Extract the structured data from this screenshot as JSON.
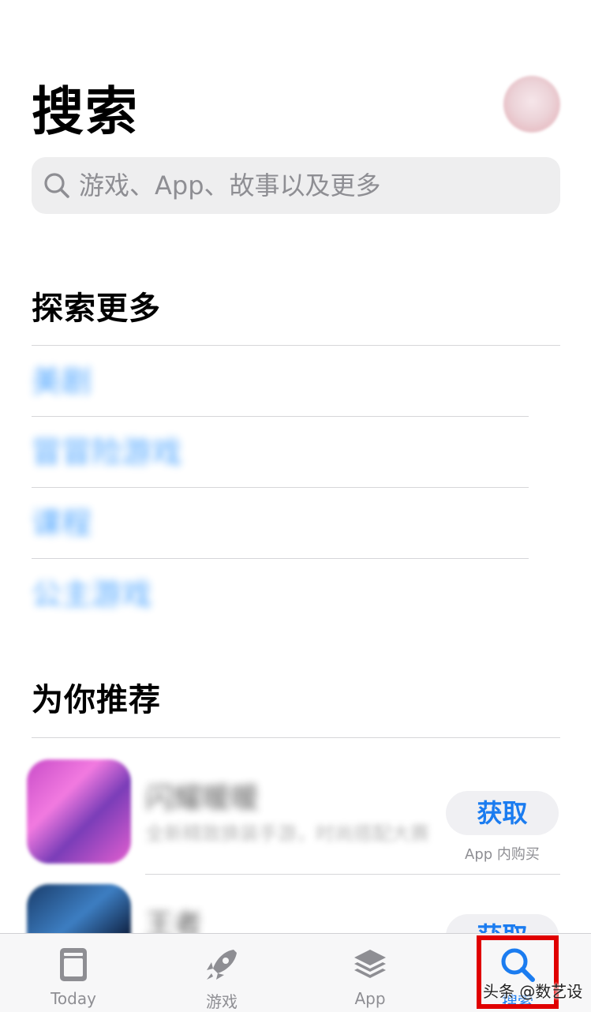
{
  "header": {
    "title": "搜索"
  },
  "search": {
    "placeholder": "游戏、App、故事以及更多"
  },
  "explore": {
    "title": "探索更多",
    "items": [
      {
        "label": "美剧"
      },
      {
        "label": "冒冒险游戏"
      },
      {
        "label": "课程"
      },
      {
        "label": "公主游戏"
      }
    ]
  },
  "recommend": {
    "title": "为你推荐",
    "apps": [
      {
        "name": "闪耀暖暖",
        "subtitle": "全新精致换装手游，时尚搭配大赛",
        "button": "获取",
        "note": "App 内购买"
      },
      {
        "name": "王者",
        "subtitle": "",
        "button": "获取",
        "note": ""
      }
    ]
  },
  "tabbar": {
    "tabs": [
      {
        "label": "Today",
        "icon": "today-icon",
        "active": false
      },
      {
        "label": "游戏",
        "icon": "rocket-icon",
        "active": false
      },
      {
        "label": "App",
        "icon": "layers-icon",
        "active": false
      },
      {
        "label": "搜索",
        "icon": "search-icon",
        "active": true
      }
    ]
  },
  "overlay": {
    "watermark": "头条 @数艺设",
    "highlight_color": "#e00000"
  },
  "colors": {
    "accent": "#1b7cf0",
    "link": "#1b8bff",
    "secondary_text": "#8e8e93"
  }
}
